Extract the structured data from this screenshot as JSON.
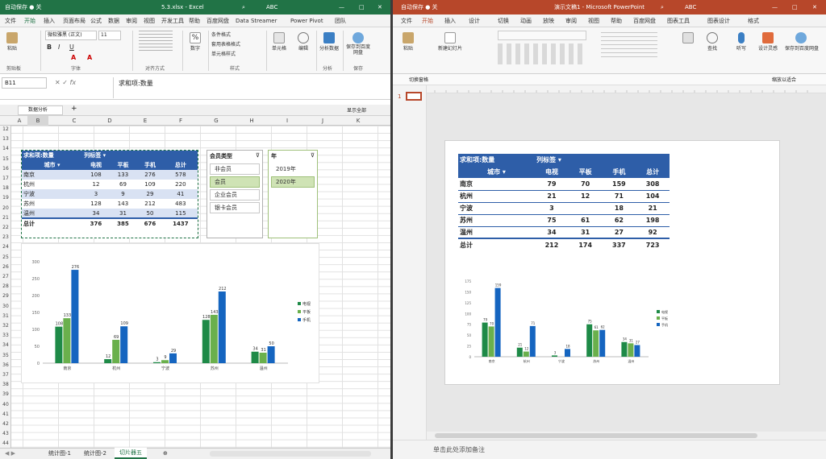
{
  "excel": {
    "title_left": "自动保存 ● 关",
    "title_doc": "5.3.xlsx - Excel",
    "title_user": "ABC",
    "tabs": [
      "文件",
      "开始",
      "插入",
      "页面布局",
      "公式",
      "数据",
      "审阅",
      "视图",
      "开发工具",
      "帮助",
      "百度网盘",
      "Data Streamer",
      "Power Pivot",
      "团队"
    ],
    "active_tab": "开始",
    "ribbon": {
      "paste": "粘贴",
      "clipboard": "剪贴板",
      "font_name": "微软雅黑 (正文)",
      "font_size": "11",
      "font_group": "字体",
      "align_group": "对齐方式",
      "number": "数字",
      "cond_format": "条件格式",
      "table_format": "套用表格格式",
      "cell_style": "单元格样式",
      "styles_group": "样式",
      "cells": "单元格",
      "edit": "编辑",
      "analyze": "分析数据",
      "analysis_group": "分析",
      "save_baidu": "保存到百度网盘",
      "save_group": "保存"
    },
    "name_box": "B11",
    "formula": "求和项:数量",
    "sheet_name": "数据分析",
    "show_all": "显示全部",
    "col_headers": [
      "A",
      "B",
      "C",
      "D",
      "E",
      "F",
      "G",
      "H",
      "I",
      "J",
      "K"
    ],
    "row_headers": [
      "12",
      "13",
      "14",
      "15",
      "16",
      "17",
      "18",
      "19",
      "20",
      "21",
      "22",
      "23",
      "24",
      "25",
      "26",
      "27",
      "28",
      "29",
      "30",
      "31",
      "32",
      "33",
      "34",
      "35",
      "36",
      "37",
      "38",
      "39",
      "40",
      "41",
      "42",
      "43",
      "44"
    ],
    "pivot": {
      "value_label": "求和项:数量",
      "col_label": "列标签",
      "row_label": "城市",
      "headers": [
        "电视",
        "平板",
        "手机",
        "总计"
      ],
      "rows": [
        {
          "city": "南京",
          "vals": [
            "108",
            "133",
            "276",
            "578"
          ]
        },
        {
          "city": "杭州",
          "vals": [
            "12",
            "69",
            "109",
            "220"
          ]
        },
        {
          "city": "宁波",
          "vals": [
            "3",
            "9",
            "29",
            "41"
          ]
        },
        {
          "city": "苏州",
          "vals": [
            "128",
            "143",
            "212",
            "483"
          ]
        },
        {
          "city": "温州",
          "vals": [
            "34",
            "31",
            "50",
            "115"
          ]
        }
      ],
      "total": {
        "city": "总计",
        "vals": [
          "376",
          "385",
          "676",
          "1437"
        ]
      }
    },
    "slicer_type": {
      "title": "会员类型",
      "items": [
        "非会员",
        "会员",
        "企业会员",
        "银卡会员"
      ],
      "selected": "会员"
    },
    "slicer_year": {
      "title": "年",
      "items": [
        "2019年",
        "2020年"
      ],
      "selected": "2020年"
    },
    "sheet_tabs": [
      "统计图-1",
      "统计图-2",
      "切片器五"
    ],
    "active_sheet": "切片器五"
  },
  "powerpoint": {
    "title_left": "自动保存 ● 关",
    "title_doc": "演示文稿1 - Microsoft PowerPoint",
    "title_user": "ABC",
    "tabs": [
      "文件",
      "开始",
      "插入",
      "设计",
      "切换",
      "动画",
      "放映",
      "审阅",
      "视图",
      "帮助",
      "百度网盘",
      "图表工具",
      "图表设计",
      "格式"
    ],
    "active_tab": "开始",
    "ribbon": {
      "paste": "粘贴",
      "new_slide": "新建幻灯片",
      "find": "查找",
      "dictate": "听写",
      "design": "设计灵感",
      "save": "保存到百度网盘"
    },
    "toolbar": "切换窗格",
    "fit": "缩放以适合",
    "slide_number": "1",
    "notes": "单击此处添加备注",
    "table": {
      "value_label": "求和项:数量",
      "col_label": "列标签",
      "row_label": "城市",
      "headers": [
        "电视",
        "平板",
        "手机",
        "总计"
      ],
      "rows": [
        {
          "city": "南京",
          "vals": [
            "79",
            "70",
            "159",
            "308"
          ]
        },
        {
          "city": "杭州",
          "vals": [
            "21",
            "12",
            "71",
            "104"
          ]
        },
        {
          "city": "宁波",
          "vals": [
            "3",
            "",
            "18",
            "21"
          ]
        },
        {
          "city": "苏州",
          "vals": [
            "75",
            "61",
            "62",
            "198"
          ]
        },
        {
          "city": "温州",
          "vals": [
            "34",
            "31",
            "27",
            "92"
          ]
        }
      ],
      "total": {
        "city": "总计",
        "vals": [
          "212",
          "174",
          "337",
          "723"
        ]
      }
    }
  },
  "colors": {
    "excel": "#217346",
    "ppt": "#b7472a",
    "s1": "#1e8a47",
    "s2": "#6ab04c",
    "s3": "#1565c0",
    "pivot_hdr": "#2e5ea8"
  },
  "chart_data": [
    {
      "type": "bar",
      "categories": [
        "南京",
        "杭州",
        "宁波",
        "苏州",
        "温州"
      ],
      "series": [
        {
          "name": "电视",
          "values": [
            108,
            12,
            3,
            128,
            34
          ]
        },
        {
          "name": "平板",
          "values": [
            133,
            69,
            9,
            143,
            31
          ]
        },
        {
          "name": "手机",
          "values": [
            276,
            109,
            29,
            212,
            50
          ]
        }
      ],
      "ylim": [
        0,
        300
      ],
      "yticks": [
        0,
        50,
        100,
        150,
        200,
        250,
        300
      ],
      "legend": "right"
    },
    {
      "type": "bar",
      "categories": [
        "南京",
        "杭州",
        "宁波",
        "苏州",
        "温州"
      ],
      "series": [
        {
          "name": "电视",
          "values": [
            79,
            21,
            3,
            75,
            34
          ]
        },
        {
          "name": "平板",
          "values": [
            70,
            12,
            0,
            61,
            31
          ]
        },
        {
          "name": "手机",
          "values": [
            159,
            71,
            18,
            62,
            27
          ]
        }
      ],
      "ylim": [
        0,
        175
      ],
      "yticks": [
        0,
        25,
        50,
        75,
        100,
        125,
        150,
        175
      ],
      "legend": "right"
    }
  ]
}
